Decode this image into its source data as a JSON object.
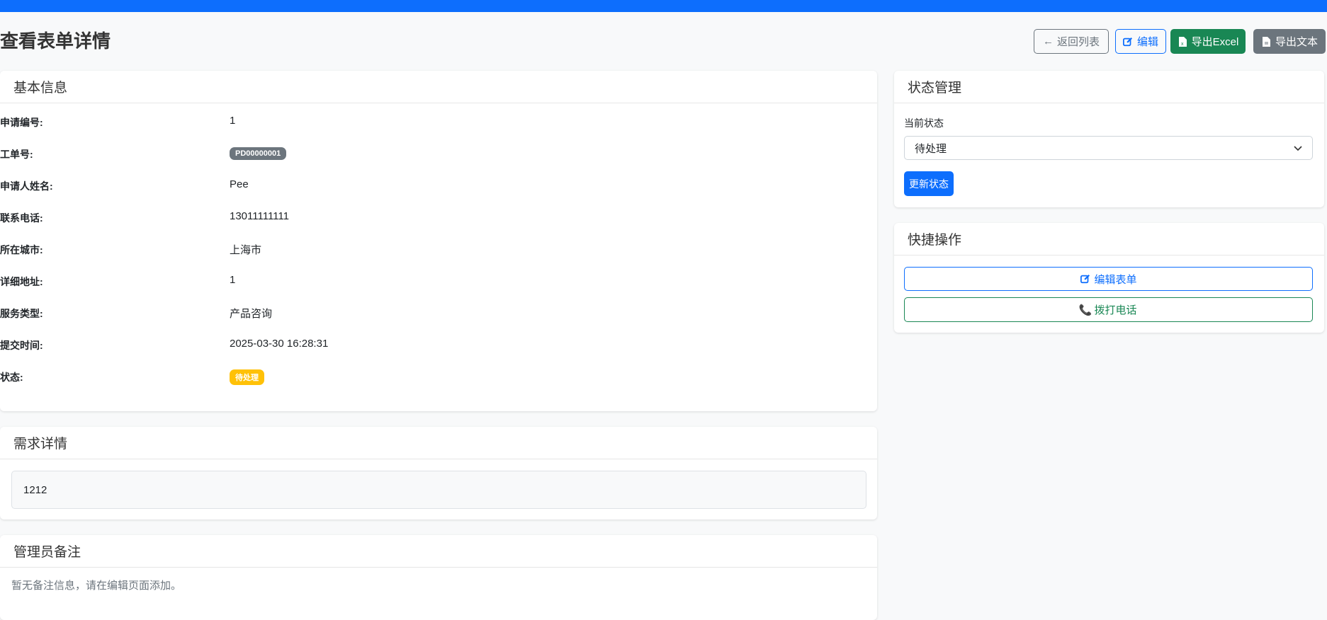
{
  "page": {
    "title": "查看表单详情"
  },
  "toolbar": {
    "back": "返回列表",
    "edit": "编辑",
    "export_excel": "导出Excel",
    "export_text": "导出文本"
  },
  "basic": {
    "title": "基本信息",
    "fields": [
      {
        "label": "申请编号:",
        "value": "1"
      },
      {
        "label": "工单号:",
        "value": "PD00000001"
      },
      {
        "label": "申请人姓名:",
        "value": "Pee"
      },
      {
        "label": "联系电话:",
        "value": "13011111111"
      },
      {
        "label": "所在城市:",
        "value": "上海市"
      },
      {
        "label": "详细地址:",
        "value": "1"
      },
      {
        "label": "服务类型:",
        "value": "产品咨询"
      },
      {
        "label": "提交时间:",
        "value": "2025-03-30 16:28:31"
      },
      {
        "label": "状态:",
        "value": "待处理"
      }
    ]
  },
  "requirement": {
    "title": "需求详情",
    "content": "1212"
  },
  "notes": {
    "title": "管理员备注",
    "content": "暂无备注信息，请在编辑页面添加。"
  },
  "status": {
    "title": "状态管理",
    "label": "当前状态",
    "selected": "待处理",
    "update_button": "更新状态"
  },
  "quick": {
    "title": "快捷操作",
    "edit_form": "编辑表单",
    "call": "拨打电话"
  },
  "colors": {
    "primary": "#0d6efd",
    "success": "#198754",
    "secondary": "#6c757d",
    "warning": "#ffc107"
  }
}
